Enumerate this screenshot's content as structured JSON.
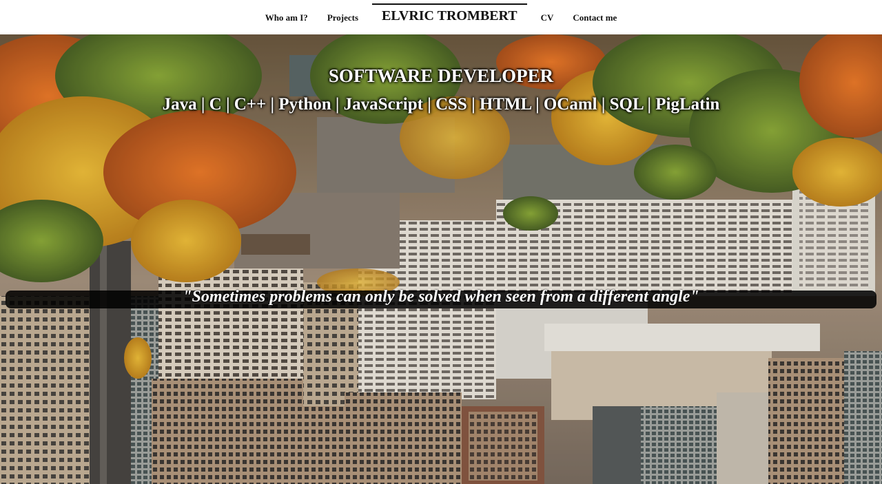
{
  "nav": {
    "links": [
      "Who am I?",
      "Projects",
      "CV",
      "Contact me"
    ],
    "brand": "ELVRIC TROMBERT"
  },
  "hero": {
    "title": "SOFTWARE DEVELOPER",
    "skills": "Java | C | C++ | Python | JavaScript | CSS | HTML | OCaml | SQL | PigLatin",
    "quote": "\"Sometimes problems can only be solved when seen from a different angle\""
  },
  "colors": {
    "nav_bg": "#ffffff",
    "text_dark": "#111111",
    "quote_bar": "#000000",
    "hero_text": "#ffffff",
    "foliage_orange": "#d9702a",
    "foliage_yellow": "#e0a82a",
    "foliage_green": "#5e7a2c",
    "building_cream": "#e8ddc8"
  }
}
